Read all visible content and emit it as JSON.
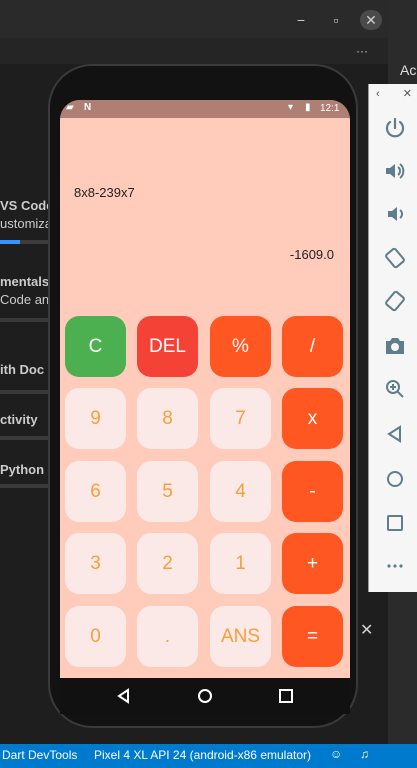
{
  "host": {
    "window_controls": [
      "−",
      "▫",
      "✕"
    ],
    "overflow_label": "···",
    "sidebar": {
      "items": [
        {
          "text": "VS Code",
          "bold": true
        },
        {
          "text": "ustomiza",
          "bold": false
        },
        {
          "text": "mentals",
          "bold": true
        },
        {
          "text": "Code and",
          "bold": false
        },
        {
          "text": "ith Doc",
          "bold": true
        },
        {
          "text": "ctivity",
          "bold": true
        },
        {
          "text": "Python c",
          "bold": true
        }
      ]
    },
    "right_header": "Ac",
    "status_bar": {
      "devtools": "Dart DevTools",
      "device": "Pixel 4 XL API 24 (android-x86 emulator)"
    },
    "emulator_tools": [
      "power-icon",
      "volume-up-icon",
      "volume-down-icon",
      "rotate-left-icon",
      "rotate-right-icon",
      "camera-icon",
      "zoom-icon",
      "back-icon",
      "home-icon",
      "overview-icon",
      "more-icon"
    ]
  },
  "phone": {
    "status": {
      "time": "12:1"
    },
    "calculator": {
      "expression": "8x8-239x7",
      "result": "-1609.0",
      "keys": [
        [
          "C",
          "DEL",
          "%",
          "/"
        ],
        [
          "9",
          "8",
          "7",
          "x"
        ],
        [
          "6",
          "5",
          "4",
          "-"
        ],
        [
          "3",
          "2",
          "1",
          "+"
        ],
        [
          "0",
          ".",
          "ANS",
          "="
        ]
      ]
    }
  },
  "colors": {
    "screen_bg": "#ffccbc",
    "key_light": "#fbe9e7",
    "key_orange": "#ff5722",
    "key_clear": "#4caf50",
    "key_delete": "#f44336",
    "digit_text": "#f5a03b",
    "status_blue": "#007acc"
  }
}
